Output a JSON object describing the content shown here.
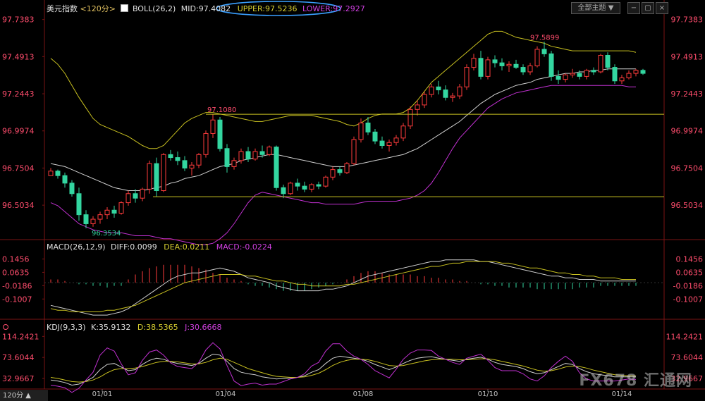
{
  "header": {
    "symbol": "美元指数",
    "period": "<120分>",
    "boll_label": "BOLL(26,2)",
    "mid_label": "MID:97.4082",
    "upper_label": "UPPER:97.5236",
    "lower_label": "LOWER:97.2927",
    "theme_button": "全部主题",
    "theme_arrow": "▼"
  },
  "macd_header": {
    "name": "MACD(26,12,9)",
    "diff": "DIFF:0.0099",
    "dea": "DEA:0.0211",
    "macd": "MACD:-0.0224"
  },
  "kdj_header": {
    "name": "KDJ(9,3,3)",
    "k": "K:35.9132",
    "d": "D:38.5365",
    "j": "J:30.6668"
  },
  "footer": {
    "period_button": "120分 ▲"
  },
  "watermark": "FX678 汇通网",
  "colors": {
    "up": "#ff3b3b",
    "down": "#33d6a0",
    "mid": "#d0d0d0",
    "upper": "#c8c020",
    "lower": "#c030d0",
    "hline": "#c8c020",
    "axis_text": "#ff4d6d",
    "grid": "#7a1414",
    "highlight_ring": "#3aa0ff"
  },
  "chart_data": {
    "type": "candlestick",
    "price_axis_ticks": [
      97.7383,
      97.4913,
      97.2443,
      96.9974,
      96.7504,
      96.5034
    ],
    "macd_axis_ticks": [
      0.1456,
      0.0635,
      -0.0186,
      -0.1007
    ],
    "kdj_axis_ticks": [
      114.2421,
      73.6044,
      32.9667
    ],
    "date_labels": [
      "01/01",
      "01/04",
      "01/08",
      "01/10",
      "01/14"
    ],
    "annotations": [
      {
        "label": "97.5899",
        "value": 97.5899
      },
      {
        "label": "97.1080",
        "value": 97.108
      },
      {
        "label": "96.3534",
        "value": 96.3534
      }
    ],
    "hlines": [
      97.108,
      96.5599
    ],
    "candles": [
      [
        96.7,
        96.75,
        96.7,
        96.73
      ],
      [
        96.73,
        96.74,
        96.68,
        96.7
      ],
      [
        96.7,
        96.72,
        96.62,
        96.65
      ],
      [
        96.65,
        96.67,
        96.56,
        96.58
      ],
      [
        96.58,
        96.62,
        96.4,
        96.44
      ],
      [
        96.44,
        96.47,
        96.35,
        96.38
      ],
      [
        96.38,
        96.43,
        96.36,
        96.41
      ],
      [
        96.41,
        96.46,
        96.38,
        96.44
      ],
      [
        96.44,
        96.49,
        96.41,
        96.47
      ],
      [
        96.47,
        96.5,
        96.42,
        96.45
      ],
      [
        96.45,
        96.53,
        96.44,
        96.52
      ],
      [
        96.52,
        96.6,
        96.5,
        96.58
      ],
      [
        96.58,
        96.61,
        96.52,
        96.55
      ],
      [
        96.55,
        96.62,
        96.53,
        96.61
      ],
      [
        96.61,
        96.8,
        96.58,
        96.78
      ],
      [
        96.78,
        96.82,
        96.56,
        96.6
      ],
      [
        96.6,
        96.85,
        96.59,
        96.84
      ],
      [
        96.84,
        96.87,
        96.8,
        96.82
      ],
      [
        96.82,
        96.86,
        96.77,
        96.8
      ],
      [
        96.8,
        96.83,
        96.73,
        96.75
      ],
      [
        96.75,
        96.79,
        96.7,
        96.77
      ],
      [
        96.77,
        96.85,
        96.75,
        96.84
      ],
      [
        96.84,
        97.0,
        96.82,
        96.98
      ],
      [
        96.98,
        97.11,
        96.95,
        97.07
      ],
      [
        97.07,
        97.09,
        96.86,
        96.88
      ],
      [
        96.88,
        96.91,
        96.72,
        96.76
      ],
      [
        96.76,
        96.82,
        96.74,
        96.8
      ],
      [
        96.8,
        96.88,
        96.78,
        96.86
      ],
      [
        96.86,
        96.89,
        96.79,
        96.81
      ],
      [
        96.81,
        96.88,
        96.8,
        96.86
      ],
      [
        96.86,
        96.9,
        96.82,
        96.84
      ],
      [
        96.84,
        96.9,
        96.83,
        96.89
      ],
      [
        96.89,
        96.9,
        96.6,
        96.62
      ],
      [
        96.62,
        96.64,
        96.55,
        96.58
      ],
      [
        96.58,
        96.66,
        96.57,
        96.65
      ],
      [
        96.65,
        96.68,
        96.6,
        96.63
      ],
      [
        96.63,
        96.66,
        96.59,
        96.61
      ],
      [
        96.61,
        96.65,
        96.59,
        96.64
      ],
      [
        96.64,
        96.66,
        96.61,
        96.63
      ],
      [
        96.63,
        96.7,
        96.62,
        96.69
      ],
      [
        96.69,
        96.76,
        96.67,
        96.74
      ],
      [
        96.74,
        96.76,
        96.7,
        96.72
      ],
      [
        96.72,
        96.79,
        96.71,
        96.78
      ],
      [
        96.78,
        96.96,
        96.77,
        96.94
      ],
      [
        96.94,
        97.08,
        96.92,
        97.05
      ],
      [
        97.05,
        97.09,
        96.97,
        96.99
      ],
      [
        96.99,
        97.01,
        96.91,
        96.93
      ],
      [
        96.93,
        96.96,
        96.88,
        96.9
      ],
      [
        96.9,
        96.94,
        96.86,
        96.92
      ],
      [
        96.92,
        96.97,
        96.9,
        96.95
      ],
      [
        96.95,
        97.05,
        96.93,
        97.03
      ],
      [
        97.03,
        97.16,
        97.01,
        97.14
      ],
      [
        97.14,
        97.2,
        97.1,
        97.17
      ],
      [
        97.17,
        97.26,
        97.15,
        97.24
      ],
      [
        97.24,
        97.31,
        97.22,
        97.29
      ],
      [
        97.29,
        97.33,
        97.24,
        97.27
      ],
      [
        97.27,
        97.3,
        97.2,
        97.22
      ],
      [
        97.22,
        97.25,
        97.19,
        97.23
      ],
      [
        97.23,
        97.31,
        97.21,
        97.29
      ],
      [
        97.29,
        97.44,
        97.27,
        97.42
      ],
      [
        97.42,
        97.51,
        97.4,
        97.48
      ],
      [
        97.48,
        97.53,
        97.34,
        97.36
      ],
      [
        97.36,
        97.49,
        97.34,
        97.47
      ],
      [
        97.47,
        97.5,
        97.42,
        97.45
      ],
      [
        97.45,
        97.48,
        97.4,
        97.43
      ],
      [
        97.43,
        97.46,
        97.39,
        97.44
      ],
      [
        97.44,
        97.47,
        97.41,
        97.42
      ],
      [
        97.42,
        97.44,
        97.37,
        97.39
      ],
      [
        97.39,
        97.45,
        97.37,
        97.43
      ],
      [
        97.43,
        97.56,
        97.42,
        97.54
      ],
      [
        97.54,
        97.59,
        97.49,
        97.51
      ],
      [
        97.51,
        97.53,
        97.33,
        97.36
      ],
      [
        97.36,
        97.4,
        97.31,
        97.34
      ],
      [
        97.34,
        97.38,
        97.32,
        97.37
      ],
      [
        97.37,
        97.41,
        97.35,
        97.38
      ],
      [
        97.38,
        97.4,
        97.34,
        97.36
      ],
      [
        97.36,
        97.41,
        97.34,
        97.4
      ],
      [
        97.4,
        97.42,
        97.37,
        97.39
      ],
      [
        97.39,
        97.51,
        97.38,
        97.5
      ],
      [
        97.5,
        97.52,
        97.4,
        97.42
      ],
      [
        97.42,
        97.44,
        97.31,
        97.33
      ],
      [
        97.33,
        97.37,
        97.31,
        97.35
      ],
      [
        97.35,
        97.4,
        97.34,
        97.38
      ],
      [
        97.38,
        97.41,
        97.36,
        97.4
      ],
      [
        97.4,
        97.41,
        97.37,
        97.38
      ]
    ],
    "mid": [
      96.78,
      96.77,
      96.76,
      96.74,
      96.72,
      96.7,
      96.68,
      96.66,
      96.64,
      96.62,
      96.61,
      96.6,
      96.6,
      96.6,
      96.61,
      96.62,
      96.63,
      96.65,
      96.66,
      96.68,
      96.69,
      96.7,
      96.72,
      96.74,
      96.76,
      96.77,
      96.78,
      96.8,
      96.81,
      96.82,
      96.83,
      96.84,
      96.84,
      96.83,
      96.82,
      96.81,
      96.8,
      96.79,
      96.78,
      96.77,
      96.76,
      96.76,
      96.76,
      96.77,
      96.78,
      96.79,
      96.8,
      96.81,
      96.82,
      96.83,
      96.84,
      96.86,
      96.88,
      96.91,
      96.94,
      96.97,
      97.0,
      97.03,
      97.06,
      97.1,
      97.14,
      97.18,
      97.21,
      97.24,
      97.26,
      97.28,
      97.3,
      97.31,
      97.32,
      97.34,
      97.35,
      97.36,
      97.37,
      97.38,
      97.38,
      97.39,
      97.39,
      97.4,
      97.4,
      97.41,
      97.41,
      97.41,
      97.41,
      97.41
    ],
    "upper": [
      97.48,
      97.44,
      97.38,
      97.3,
      97.22,
      97.15,
      97.08,
      97.04,
      97.02,
      97.0,
      96.98,
      96.96,
      96.93,
      96.9,
      96.88,
      96.88,
      96.9,
      96.95,
      97.0,
      97.05,
      97.08,
      97.1,
      97.12,
      97.12,
      97.11,
      97.1,
      97.09,
      97.08,
      97.07,
      97.06,
      97.06,
      97.07,
      97.08,
      97.09,
      97.1,
      97.1,
      97.1,
      97.1,
      97.09,
      97.08,
      97.07,
      97.06,
      97.04,
      97.03,
      97.05,
      97.08,
      97.1,
      97.11,
      97.11,
      97.11,
      97.12,
      97.15,
      97.2,
      97.26,
      97.32,
      97.36,
      97.4,
      97.44,
      97.48,
      97.52,
      97.56,
      97.6,
      97.64,
      97.66,
      97.66,
      97.64,
      97.62,
      97.61,
      97.6,
      97.59,
      97.58,
      97.56,
      97.55,
      97.54,
      97.53,
      97.53,
      97.53,
      97.53,
      97.53,
      97.53,
      97.53,
      97.53,
      97.53,
      97.52
    ],
    "lower": [
      96.52,
      96.5,
      96.46,
      96.42,
      96.38,
      96.36,
      96.34,
      96.33,
      96.32,
      96.32,
      96.32,
      96.31,
      96.3,
      96.3,
      96.3,
      96.29,
      96.28,
      96.28,
      96.27,
      96.26,
      96.25,
      96.24,
      96.24,
      96.25,
      96.28,
      96.32,
      96.38,
      96.45,
      96.52,
      96.57,
      96.59,
      96.58,
      96.57,
      96.56,
      96.55,
      96.54,
      96.53,
      96.52,
      96.52,
      96.51,
      96.51,
      96.51,
      96.51,
      96.51,
      96.52,
      96.53,
      96.53,
      96.53,
      96.53,
      96.53,
      96.54,
      96.55,
      96.57,
      96.6,
      96.65,
      96.72,
      96.8,
      96.88,
      96.95,
      97.0,
      97.05,
      97.1,
      97.15,
      97.18,
      97.21,
      97.23,
      97.25,
      97.26,
      97.27,
      97.28,
      97.29,
      97.3,
      97.3,
      97.3,
      97.3,
      97.3,
      97.3,
      97.3,
      97.3,
      97.3,
      97.3,
      97.3,
      97.29,
      97.29
    ],
    "macd_hist": [
      0.02,
      0.02,
      0.01,
      0.0,
      -0.01,
      -0.01,
      -0.02,
      -0.02,
      -0.03,
      -0.02,
      -0.02,
      0.02,
      0.05,
      0.07,
      0.09,
      0.1,
      0.11,
      0.11,
      0.11,
      0.11,
      0.1,
      0.09,
      0.08,
      0.06,
      0.05,
      0.03,
      0.02,
      0.01,
      -0.01,
      -0.02,
      -0.02,
      -0.03,
      -0.04,
      -0.05,
      -0.05,
      -0.05,
      -0.05,
      -0.04,
      -0.03,
      -0.02,
      -0.01,
      0.0,
      0.02,
      0.04,
      0.06,
      0.07,
      0.07,
      0.06,
      0.05,
      0.05,
      0.05,
      0.05,
      0.04,
      0.04,
      0.03,
      0.03,
      0.02,
      0.02,
      0.01,
      0.01,
      0.0,
      -0.01,
      -0.01,
      -0.02,
      -0.02,
      -0.03,
      -0.03,
      -0.03,
      -0.03,
      -0.04,
      -0.04,
      -0.04,
      -0.04,
      -0.04,
      -0.04,
      -0.03,
      -0.03,
      -0.03,
      -0.02,
      -0.02,
      -0.02,
      -0.02,
      -0.02,
      -0.02
    ],
    "macd_diff": [
      -0.14,
      -0.15,
      -0.16,
      -0.17,
      -0.18,
      -0.19,
      -0.2,
      -0.2,
      -0.2,
      -0.19,
      -0.18,
      -0.16,
      -0.13,
      -0.1,
      -0.07,
      -0.04,
      -0.01,
      0.02,
      0.04,
      0.05,
      0.06,
      0.06,
      0.07,
      0.08,
      0.09,
      0.08,
      0.07,
      0.05,
      0.03,
      0.02,
      0.01,
      0.0,
      -0.02,
      -0.03,
      -0.04,
      -0.05,
      -0.05,
      -0.05,
      -0.05,
      -0.04,
      -0.04,
      -0.03,
      -0.02,
      0.0,
      0.02,
      0.04,
      0.05,
      0.06,
      0.07,
      0.08,
      0.09,
      0.1,
      0.11,
      0.12,
      0.13,
      0.13,
      0.14,
      0.14,
      0.14,
      0.14,
      0.14,
      0.13,
      0.13,
      0.12,
      0.11,
      0.1,
      0.09,
      0.08,
      0.07,
      0.06,
      0.05,
      0.04,
      0.04,
      0.03,
      0.03,
      0.02,
      0.02,
      0.02,
      0.01,
      0.01,
      0.01,
      0.01,
      0.01,
      0.01
    ],
    "macd_dea": [
      -0.16,
      -0.17,
      -0.17,
      -0.18,
      -0.18,
      -0.18,
      -0.18,
      -0.18,
      -0.17,
      -0.17,
      -0.16,
      -0.15,
      -0.14,
      -0.12,
      -0.1,
      -0.08,
      -0.06,
      -0.04,
      -0.02,
      0.0,
      0.01,
      0.02,
      0.03,
      0.04,
      0.05,
      0.05,
      0.05,
      0.05,
      0.04,
      0.04,
      0.03,
      0.02,
      0.01,
      0.01,
      0.0,
      -0.01,
      -0.01,
      -0.02,
      -0.02,
      -0.02,
      -0.02,
      -0.02,
      -0.01,
      -0.01,
      0.0,
      0.01,
      0.02,
      0.03,
      0.04,
      0.05,
      0.06,
      0.07,
      0.08,
      0.09,
      0.1,
      0.1,
      0.11,
      0.12,
      0.12,
      0.13,
      0.13,
      0.13,
      0.13,
      0.13,
      0.12,
      0.12,
      0.11,
      0.1,
      0.09,
      0.09,
      0.08,
      0.07,
      0.06,
      0.06,
      0.05,
      0.05,
      0.04,
      0.04,
      0.03,
      0.03,
      0.03,
      0.02,
      0.02,
      0.02
    ],
    "kdj_k": [
      30,
      28,
      25,
      20,
      22,
      28,
      35,
      50,
      60,
      62,
      55,
      48,
      50,
      60,
      68,
      72,
      70,
      65,
      62,
      60,
      58,
      62,
      72,
      80,
      78,
      66,
      52,
      45,
      42,
      40,
      36,
      34,
      32,
      33,
      34,
      35,
      38,
      45,
      50,
      62,
      72,
      76,
      74,
      72,
      70,
      66,
      60,
      55,
      50,
      55,
      62,
      68,
      72,
      74,
      75,
      72,
      70,
      68,
      66,
      70,
      72,
      74,
      70,
      64,
      60,
      58,
      56,
      52,
      46,
      42,
      44,
      50,
      56,
      62,
      60,
      52,
      46,
      42,
      40,
      38,
      36,
      36,
      36,
      36
    ],
    "kdj_d": [
      35,
      33,
      30,
      27,
      26,
      27,
      30,
      36,
      44,
      50,
      52,
      52,
      53,
      56,
      60,
      64,
      66,
      66,
      65,
      63,
      61,
      61,
      64,
      69,
      72,
      70,
      64,
      58,
      52,
      48,
      44,
      40,
      37,
      36,
      35,
      35,
      36,
      39,
      43,
      50,
      58,
      64,
      68,
      70,
      70,
      69,
      66,
      62,
      58,
      57,
      58,
      61,
      64,
      67,
      69,
      70,
      70,
      70,
      69,
      69,
      70,
      71,
      71,
      69,
      66,
      63,
      60,
      57,
      53,
      49,
      47,
      48,
      51,
      55,
      57,
      56,
      53,
      49,
      46,
      43,
      40,
      39,
      38,
      38
    ],
    "kdj_j": [
      20,
      18,
      15,
      6,
      14,
      30,
      45,
      78,
      92,
      86,
      61,
      40,
      44,
      68,
      84,
      88,
      78,
      63,
      56,
      54,
      52,
      64,
      88,
      102,
      90,
      58,
      28,
      19,
      22,
      24,
      20,
      22,
      22,
      27,
      32,
      35,
      42,
      57,
      64,
      86,
      100,
      100,
      86,
      76,
      70,
      60,
      48,
      41,
      34,
      51,
      70,
      82,
      88,
      88,
      87,
      76,
      70,
      64,
      60,
      72,
      76,
      80,
      68,
      54,
      48,
      48,
      48,
      42,
      32,
      28,
      38,
      54,
      66,
      76,
      66,
      44,
      32,
      28,
      28,
      28,
      28,
      30,
      32,
      31
    ]
  }
}
